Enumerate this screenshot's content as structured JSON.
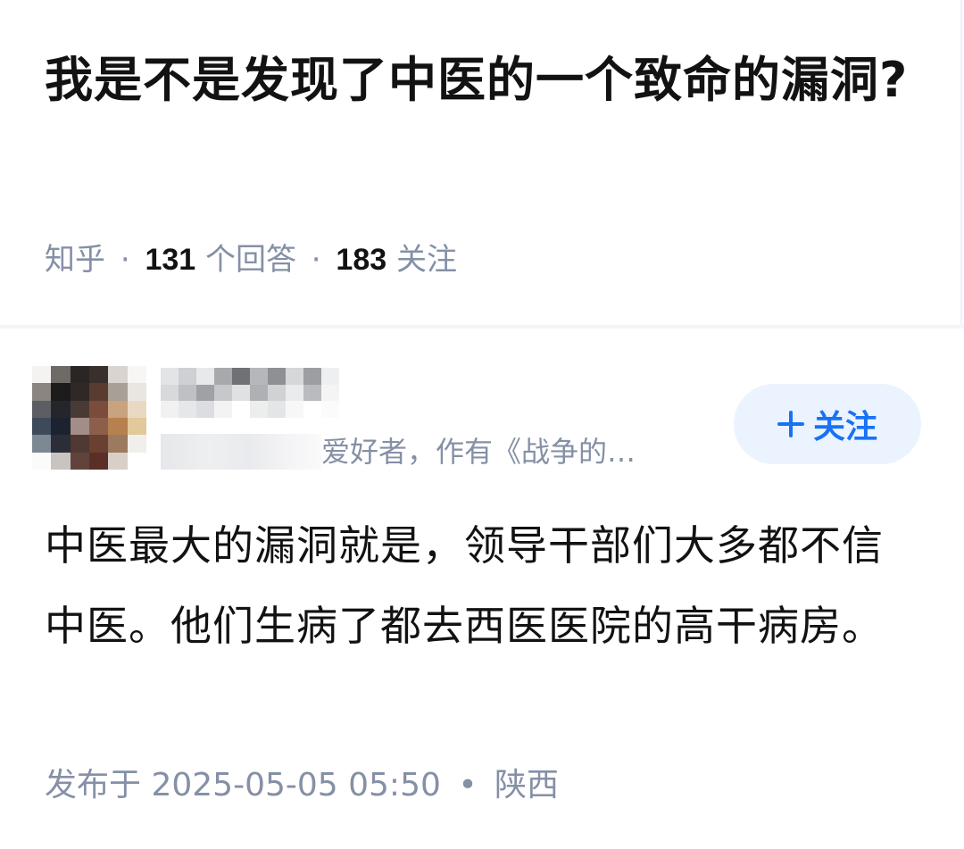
{
  "question": {
    "title": "我是不是发现了中医的一个致命的漏洞?",
    "source": "知乎",
    "answer_count": "131",
    "answer_label": "个回答",
    "follower_count": "183",
    "follower_label": "关注",
    "separator": "·"
  },
  "answer": {
    "author_bio_visible": "爱好者，作有《战争的…",
    "follow_button_label": "关注",
    "body": "中医最大的漏洞就是，领导干部们大多都不信中医。他们生病了都去西医医院的高干病房。",
    "published_label": "发布于",
    "published_time": "2025-05-05 05:50",
    "location_separator": "•",
    "location": "陕西"
  },
  "colors": {
    "title_text": "#121212",
    "meta_text": "#8590a6",
    "follow_button_bg": "#ebf3ff",
    "follow_button_text": "#1772f6",
    "divider": "#f4f5f7"
  },
  "icons": {
    "follow": "plus-icon"
  }
}
